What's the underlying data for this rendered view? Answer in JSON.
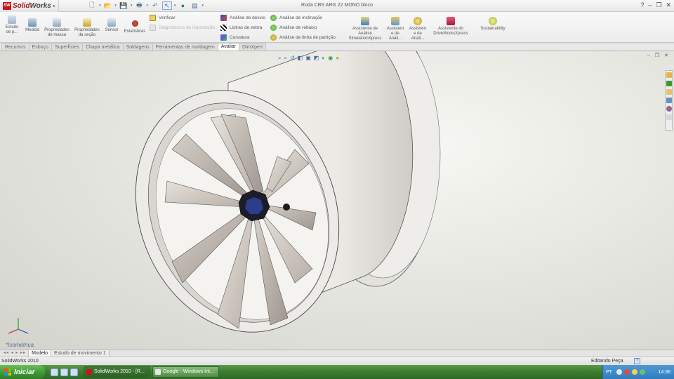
{
  "app": {
    "logo_mark": "SW",
    "logo_text_solid": "Solid",
    "logo_text_works": "Works",
    "document_title": "Roda CBS ARG 22 MONO bloco"
  },
  "quick_access": [
    "new-document-icon",
    "open-icon",
    "save-icon",
    "print-icon",
    "undo-icon",
    "select-icon",
    "rebuild-icon",
    "options-icon"
  ],
  "window_controls": {
    "help": "?",
    "minimize": "–",
    "restore": "❐",
    "close": "✕"
  },
  "ribbon": {
    "study": "Estudo de p...",
    "measure": "Medida",
    "mass_props_1": "Propriedades",
    "mass_props_2": "de massa",
    "section_props_1": "Propriedades",
    "section_props_2": "da seção",
    "sensor": "Sensor",
    "statistics": "Estatísticas",
    "check": "Verificar",
    "import_diag": "Diagnósticos de importação",
    "deviation": "Análise de desvio",
    "zebra": "Listras de zebra",
    "curvature": "Curvatura",
    "draft": "Análise de inclinação",
    "undercut": "Análise de rebaixo",
    "parting": "Análise de linha de partição",
    "simxpress_1": "Assistente de",
    "simxpress_2": "Análise",
    "simxpress_3": "SimulationXpress",
    "flo_1": "Assistent",
    "flo_2": "e de",
    "flo_3": "Análi...",
    "dfm_1": "Assistent",
    "dfm_2": "e de",
    "dfm_3": "Análi...",
    "drive_1": "Assistente do",
    "drive_2": "DriveWorksXpress",
    "sustainability": "Sustainability"
  },
  "tabs": [
    "Recursos",
    "Esboço",
    "Superfícies",
    "Chapa metálica",
    "Soldagens",
    "Ferramentas de moldagem",
    "Avaliar",
    "DimXpert"
  ],
  "active_tab": "Avaliar",
  "viewport": {
    "view_name": "*Isométrica",
    "heads_up_icons": [
      "zoom-fit-icon",
      "zoom-area-icon",
      "previous-view-icon",
      "section-view-icon",
      "view-orientation-icon",
      "display-style-icon",
      "hide-show-icon",
      "edit-appearance-icon",
      "apply-scene-icon"
    ]
  },
  "bottom_tabs": [
    "Modelo",
    "Estudo de movimento 1"
  ],
  "bottom_nav": "◂◂ ◂ ▸ ▸▸",
  "status": {
    "left": "SolidWorks 2010",
    "right": "Editando Peça",
    "help": "?"
  },
  "taskbar": {
    "start": "Iniciar",
    "tasks": [
      {
        "label": "SolidWorks 2010 - [R...",
        "active": true
      },
      {
        "label": "Google - Windows Int...",
        "active": false
      }
    ],
    "lang": "PT",
    "clock": "14:36"
  },
  "colors": {
    "solidworks_red": "#c8151b",
    "taskbar_green": "#3c7a30",
    "tray_blue": "#2f7cc0",
    "viewport_bg": "#e9e9e4"
  }
}
